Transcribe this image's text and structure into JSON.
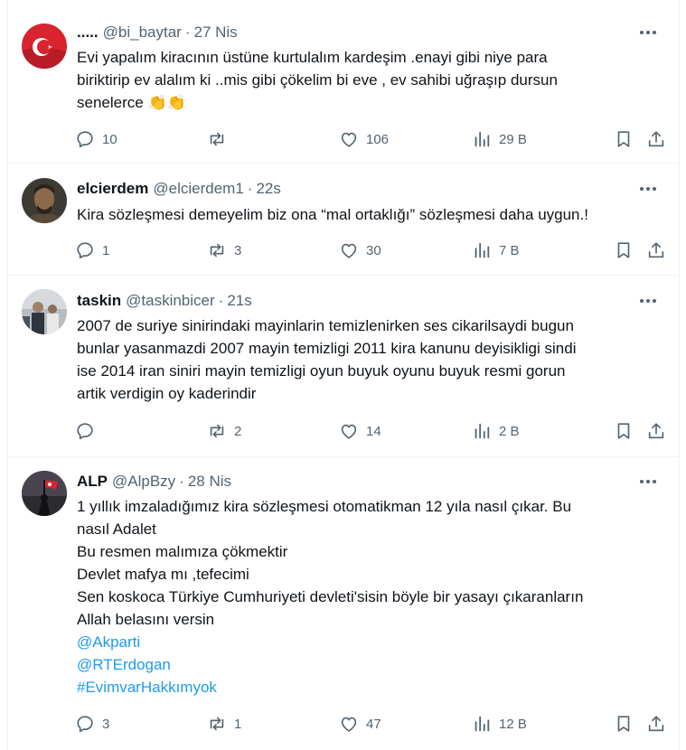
{
  "tweets": [
    {
      "name": ".....",
      "handle": "@bi_baytar",
      "time": "27 Nis",
      "lines": [
        "Evi yapalım kiracının üstüne kurtulalım kardeşim .enayi gibi niye para",
        "biriktirip ev alalım ki ..mis gibi çökelim bi eve , ev sahibi uğraşıp dursun",
        "senelerce"
      ],
      "emoji": "👏👏",
      "stats": {
        "replies": "10",
        "retweets": "",
        "likes": "106",
        "views": "29 B"
      },
      "avatar": "turkish-flag"
    },
    {
      "name": "elcierdem",
      "handle": "@elcierdem1",
      "time": "22s",
      "lines": [
        "Kira sözleşmesi demeyelim biz ona  “mal ortaklığı”  sözleşmesi daha uygun.!"
      ],
      "stats": {
        "replies": "1",
        "retweets": "3",
        "likes": "30",
        "views": "7 B"
      },
      "avatar": "warrior-portrait"
    },
    {
      "name": "taskin",
      "handle": "@taskinbicer",
      "time": "21s",
      "lines": [
        "2007 de suriye sinirindaki mayinlarin temizlenirken ses cikarilsaydi bugun",
        "bunlar yasanmazdi 2007 mayin temizligi 2011 kira kanunu deyisikligi sindi",
        "ise 2014 iran siniri mayin temizligi oyun buyuk oyunu buyuk resmi gorun",
        "artik verdigin oy kaderindir"
      ],
      "stats": {
        "replies": "",
        "retweets": "2",
        "likes": "14",
        "views": "2 B"
      },
      "avatar": "group-photo"
    },
    {
      "name": "ALP",
      "handle": "@AlpBzy",
      "time": "28 Nis",
      "lines": [
        "1 yıllık imzaladığımız kira sözleşmesi otomatikman 12 yıla nasıl çıkar. Bu",
        "nasıl Adalet",
        "Bu resmen malımıza çökmektir",
        "Devlet mafya mı ,tefecimi",
        "Sen koskoca Türkiye Cumhuriyeti devleti'sisin böyle bir yasayı çıkaranların",
        "Allah belasını versin"
      ],
      "links": [
        "@Akparti",
        "@RTErdogan",
        "#EvimvarHakkımyok"
      ],
      "stats": {
        "replies": "3",
        "retweets": "1",
        "likes": "47",
        "views": "12 B"
      },
      "avatar": "flag-silhouette"
    }
  ],
  "colors": {
    "text": "#0f1419",
    "muted": "#536471",
    "link": "#1d9bf0",
    "border": "#eff3f4"
  }
}
